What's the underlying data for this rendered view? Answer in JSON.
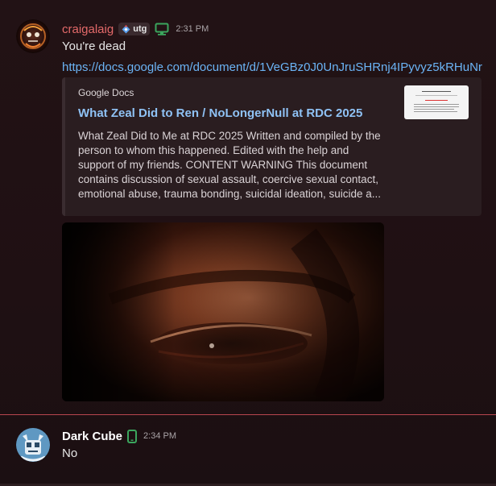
{
  "messages": [
    {
      "username": "craigalaig",
      "username_color": "#e46a6a",
      "tag": "utg",
      "device_icon": "desktop-icon",
      "timestamp": "2:31 PM",
      "text": "You're dead",
      "link": "https://docs.google.com/document/d/1VeGBz0J0UnJruSHRnj4IPyvyz5kRHuNr",
      "embed": {
        "provider": "Google Docs",
        "title": "What Zeal Did to Ren / NoLongerNull at RDC 2025",
        "description": "What Zeal Did to Me at RDC 2025 Written and compiled by the person to whom this happened. Edited with the help and support of my friends. CONTENT WARNING This document contains discussion of sexual assault, coercive sexual contact, emotional abuse, trauma bonding, suicidal ideation, suicide a..."
      }
    },
    {
      "username": "Dark Cube",
      "username_color": "#ffffff",
      "device_icon": "mobile-phone-icon",
      "timestamp": "2:34 PM",
      "text": "No"
    }
  ]
}
